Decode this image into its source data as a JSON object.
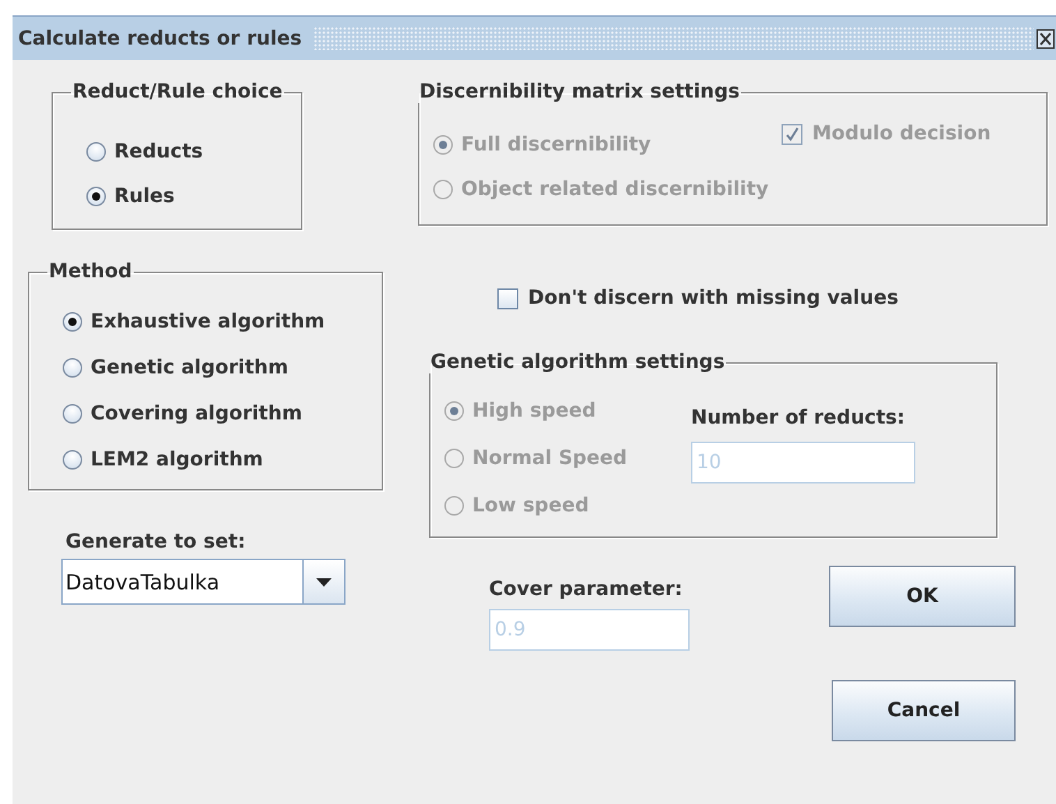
{
  "window": {
    "title": "Calculate reducts or rules"
  },
  "reduct_rule_choice": {
    "title": "Reduct/Rule choice",
    "options": [
      {
        "label": "Reducts",
        "selected": false
      },
      {
        "label": "Rules",
        "selected": true
      }
    ]
  },
  "method": {
    "title": "Method",
    "options": [
      {
        "label": "Exhaustive algorithm",
        "selected": true
      },
      {
        "label": "Genetic algorithm",
        "selected": false
      },
      {
        "label": "Covering algorithm",
        "selected": false
      },
      {
        "label": "LEM2 algorithm",
        "selected": false
      }
    ]
  },
  "generate_to_set": {
    "label": "Generate to set:",
    "value": "DatovaTabulka"
  },
  "discernibility_matrix": {
    "title": "Discernibility matrix settings",
    "disabled": true,
    "options": [
      {
        "label": "Full discernibility",
        "selected": true
      },
      {
        "label": "Object related discernibility",
        "selected": false
      }
    ],
    "modulo_decision": {
      "label": "Modulo decision",
      "checked": true
    }
  },
  "dont_discern_missing": {
    "label": "Don't discern with missing values",
    "checked": false
  },
  "genetic_settings": {
    "title": "Genetic algorithm settings",
    "disabled": true,
    "options": [
      {
        "label": "High speed",
        "selected": true
      },
      {
        "label": "Normal Speed",
        "selected": false
      },
      {
        "label": "Low speed",
        "selected": false
      }
    ],
    "number_of_reducts": {
      "label": "Number of reducts:",
      "value": "10"
    }
  },
  "cover_parameter": {
    "label": "Cover parameter:",
    "value": "0.9",
    "disabled": true
  },
  "buttons": [
    "OK",
    "Cancel"
  ]
}
